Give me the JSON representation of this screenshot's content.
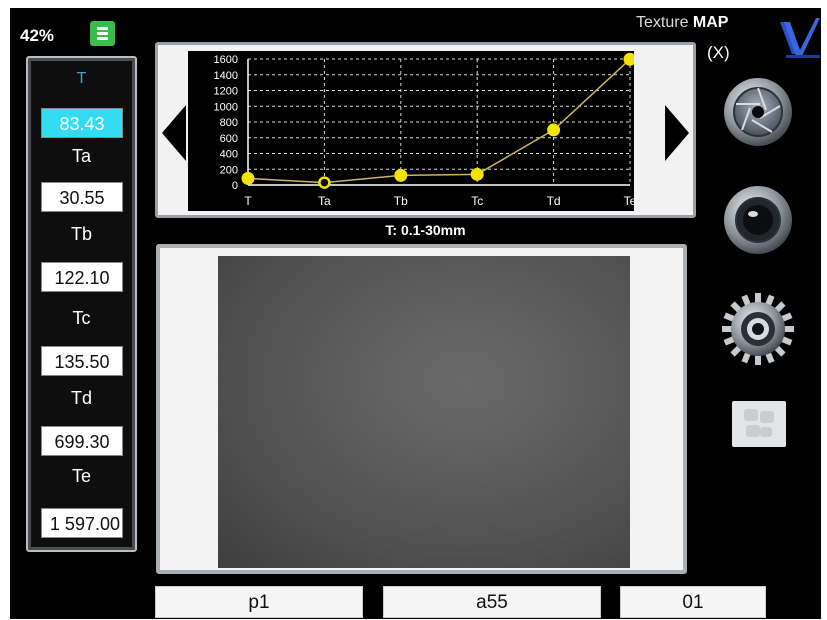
{
  "status": {
    "battery": "42%"
  },
  "header": {
    "title_prefix": "Texture",
    "title_bold": "MAP",
    "close_label": "(X)"
  },
  "parameters": [
    {
      "label": "T",
      "value": "83.43",
      "active": true
    },
    {
      "label": "Ta",
      "value": "30.55"
    },
    {
      "label": "Tb",
      "value": "122.10"
    },
    {
      "label": "Tc",
      "value": "135.50"
    },
    {
      "label": "Td",
      "value": "699.30"
    },
    {
      "label": "Te",
      "value": "1 597.00"
    }
  ],
  "chart_data": {
    "type": "line",
    "categories": [
      "T",
      "Ta",
      "Tb",
      "Tc",
      "Td",
      "Te"
    ],
    "values": [
      83.43,
      30.55,
      122.1,
      135.5,
      699.3,
      1597.0
    ],
    "ylim": [
      0,
      1600
    ],
    "yticks": [
      "0",
      "200",
      "400",
      "600",
      "800",
      "1000",
      "1200",
      "1400",
      "1600"
    ],
    "grid": true,
    "colors": {
      "line": "#c8b860",
      "marker": "#f2e400",
      "grid": "#ffffff",
      "axis": "#ffffff"
    }
  },
  "chart_caption": "T: 0.1-30mm",
  "tools": [
    "aperture-icon",
    "camera-lens-icon",
    "settings-gear-icon",
    "image-tile-icon"
  ],
  "bottom": {
    "field1": "p1",
    "field2": "a55",
    "field3": "01"
  },
  "colors": {
    "active_value": "#33dcf0",
    "battery": "#3dbb4a",
    "logo": "#2a4fc4"
  }
}
